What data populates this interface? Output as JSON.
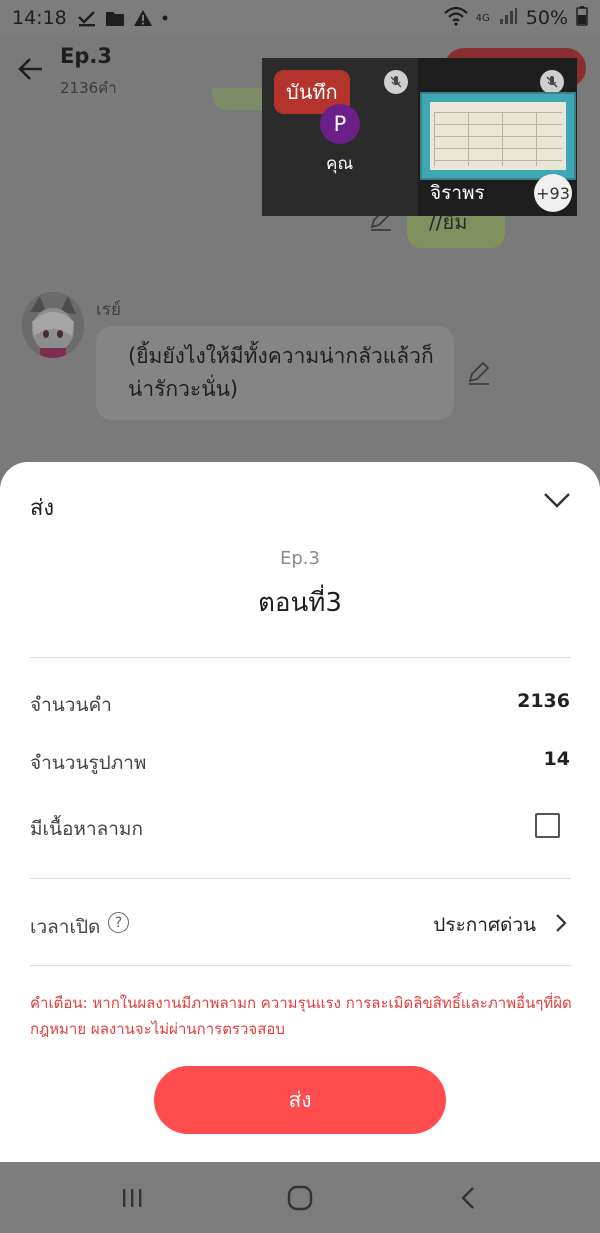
{
  "status_bar": {
    "time": "14:18",
    "network": "4G",
    "battery": "50%"
  },
  "header": {
    "title": "Ep.3",
    "word_count": "2136คำ"
  },
  "chat": {
    "bubble_right_text": "//ยิ้ม",
    "character_name": "เรย์",
    "bubble_left_text": "(ยิ้มยังไงให้มีทั้งความน่ากลัวแล้วก็น่ารักวะนั่น)"
  },
  "call": {
    "record_label": "บันทึก",
    "avatar_letter": "P",
    "you_label": "คุณ",
    "remote_name": "จิราพร",
    "participant_count": "+93"
  },
  "sheet": {
    "title": "ส่ง",
    "ep_sub": "Ep.3",
    "ep_name": "ตอนที่3",
    "rows": [
      {
        "label": "จำนวนคำ",
        "value": "2136"
      },
      {
        "label": "จำนวนรูปภาพ",
        "value": "14"
      },
      {
        "label": "มีเนื้อหาลามก"
      }
    ],
    "open_time_label": "เวลาเปิด",
    "open_time_value": "ประกาศด่วน",
    "adult_checked": false,
    "warning": "คำเตือน: หากในผลงานมีภาพลามก ความรุนแรง การละเมิดลิขสิทธิ์และภาพอื่นๆที่ผิดกฎหมาย ผลงานจะไม่ผ่านการตรวจสอบ",
    "send_label": "ส่ง"
  },
  "colors": {
    "accent": "#ff4d4d",
    "warning": "#e0413d",
    "record": "#b4342d",
    "avatar": "#6b1f8a"
  },
  "icons": [
    "check-download-icon",
    "folder-icon",
    "warning-icon",
    "wifi-icon",
    "signal-icon",
    "battery-icon",
    "back-arrow-icon",
    "edit-icon",
    "mic-off-icon",
    "chevron-down-icon",
    "help-icon",
    "chevron-right-icon",
    "recents-icon",
    "home-icon",
    "back-nav-icon"
  ]
}
